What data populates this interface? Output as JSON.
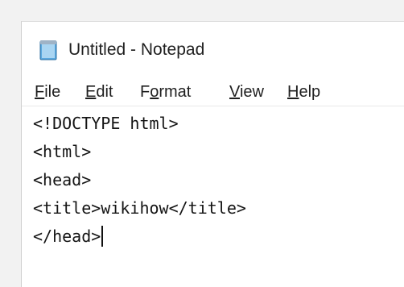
{
  "window": {
    "title": "Untitled - Notepad",
    "icon": "notepad-icon"
  },
  "menu": {
    "items": [
      {
        "first": "F",
        "rest": "ile"
      },
      {
        "first": "E",
        "rest": "dit"
      },
      {
        "pre": "F",
        "u": "o",
        "post": "rmat"
      },
      {
        "first": "V",
        "rest": "iew"
      },
      {
        "first": "H",
        "rest": "elp"
      }
    ]
  },
  "editor": {
    "lines": [
      "<!DOCTYPE html>",
      "<html>",
      "<head>",
      "<title>wikihow</title>",
      "</head>"
    ]
  },
  "colors": {
    "background": "#f2f2f2",
    "window": "#ffffff",
    "text": "#1f1f1f",
    "icon_blue": "#4aa3df"
  }
}
